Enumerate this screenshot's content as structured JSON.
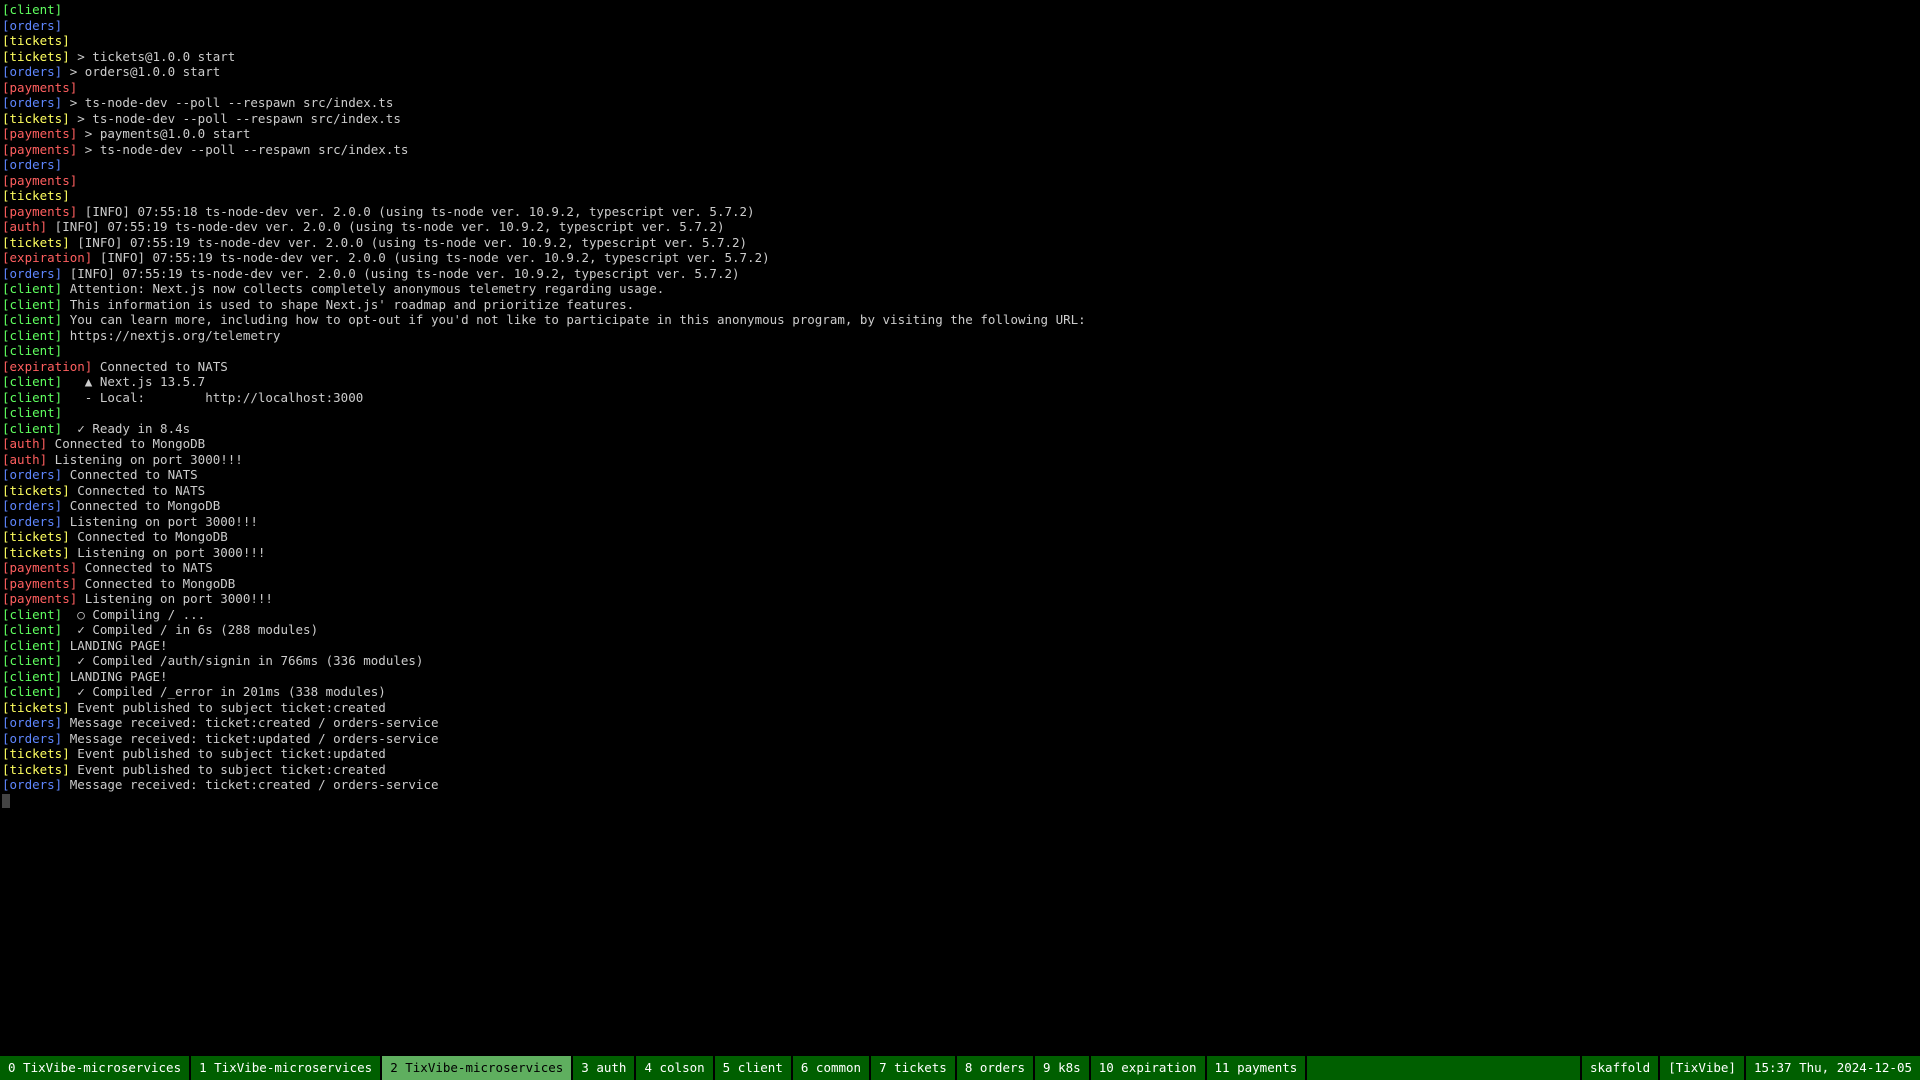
{
  "lines": [
    {
      "tag": "client",
      "text": ""
    },
    {
      "tag": "orders",
      "text": ""
    },
    {
      "tag": "tickets",
      "text": ""
    },
    {
      "tag": "tickets",
      "text": "> tickets@1.0.0 start"
    },
    {
      "tag": "orders",
      "text": "> orders@1.0.0 start"
    },
    {
      "tag": "payments",
      "text": ""
    },
    {
      "tag": "orders",
      "text": "> ts-node-dev --poll --respawn src/index.ts"
    },
    {
      "tag": "tickets",
      "text": "> ts-node-dev --poll --respawn src/index.ts"
    },
    {
      "tag": "payments",
      "text": "> payments@1.0.0 start"
    },
    {
      "tag": "payments",
      "text": "> ts-node-dev --poll --respawn src/index.ts"
    },
    {
      "tag": "orders",
      "text": ""
    },
    {
      "tag": "payments",
      "text": ""
    },
    {
      "tag": "tickets",
      "text": ""
    },
    {
      "tag": "payments",
      "text": "[INFO] 07:55:18 ts-node-dev ver. 2.0.0 (using ts-node ver. 10.9.2, typescript ver. 5.7.2)"
    },
    {
      "tag": "auth",
      "text": "[INFO] 07:55:19 ts-node-dev ver. 2.0.0 (using ts-node ver. 10.9.2, typescript ver. 5.7.2)"
    },
    {
      "tag": "tickets",
      "text": "[INFO] 07:55:19 ts-node-dev ver. 2.0.0 (using ts-node ver. 10.9.2, typescript ver. 5.7.2)"
    },
    {
      "tag": "expiration",
      "text": "[INFO] 07:55:19 ts-node-dev ver. 2.0.0 (using ts-node ver. 10.9.2, typescript ver. 5.7.2)"
    },
    {
      "tag": "orders",
      "text": "[INFO] 07:55:19 ts-node-dev ver. 2.0.0 (using ts-node ver. 10.9.2, typescript ver. 5.7.2)"
    },
    {
      "tag": "client",
      "text": "Attention: Next.js now collects completely anonymous telemetry regarding usage."
    },
    {
      "tag": "client",
      "text": "This information is used to shape Next.js' roadmap and prioritize features."
    },
    {
      "tag": "client",
      "text": "You can learn more, including how to opt-out if you'd not like to participate in this anonymous program, by visiting the following URL:"
    },
    {
      "tag": "client",
      "text": "https://nextjs.org/telemetry"
    },
    {
      "tag": "client",
      "text": ""
    },
    {
      "tag": "expiration",
      "text": "Connected to NATS"
    },
    {
      "tag": "client",
      "text": "  ▲ Next.js 13.5.7"
    },
    {
      "tag": "client",
      "text": "  - Local:        http://localhost:3000"
    },
    {
      "tag": "client",
      "text": ""
    },
    {
      "tag": "client",
      "text": " ✓ Ready in 8.4s"
    },
    {
      "tag": "auth",
      "text": "Connected to MongoDB"
    },
    {
      "tag": "auth",
      "text": "Listening on port 3000!!!"
    },
    {
      "tag": "orders",
      "text": "Connected to NATS"
    },
    {
      "tag": "tickets",
      "text": "Connected to NATS"
    },
    {
      "tag": "orders",
      "text": "Connected to MongoDB"
    },
    {
      "tag": "orders",
      "text": "Listening on port 3000!!!"
    },
    {
      "tag": "tickets",
      "text": "Connected to MongoDB"
    },
    {
      "tag": "tickets",
      "text": "Listening on port 3000!!!"
    },
    {
      "tag": "payments",
      "text": "Connected to NATS"
    },
    {
      "tag": "payments",
      "text": "Connected to MongoDB"
    },
    {
      "tag": "payments",
      "text": "Listening on port 3000!!!"
    },
    {
      "tag": "client",
      "text": " ○ Compiling / ..."
    },
    {
      "tag": "client",
      "text": " ✓ Compiled / in 6s (288 modules)"
    },
    {
      "tag": "client",
      "text": "LANDING PAGE!"
    },
    {
      "tag": "client",
      "text": " ✓ Compiled /auth/signin in 766ms (336 modules)"
    },
    {
      "tag": "client",
      "text": "LANDING PAGE!"
    },
    {
      "tag": "client",
      "text": " ✓ Compiled /_error in 201ms (338 modules)"
    },
    {
      "tag": "tickets",
      "text": "Event published to subject ticket:created"
    },
    {
      "tag": "orders",
      "text": "Message received: ticket:created / orders-service"
    },
    {
      "tag": "orders",
      "text": "Message received: ticket:updated / orders-service"
    },
    {
      "tag": "tickets",
      "text": "Event published to subject ticket:updated"
    },
    {
      "tag": "tickets",
      "text": "Event published to subject ticket:created"
    },
    {
      "tag": "orders",
      "text": "Message received: ticket:created / orders-service"
    }
  ],
  "statusbar": {
    "windows": [
      {
        "index": "0",
        "name": "TixVibe-microservices",
        "active": false
      },
      {
        "index": "1",
        "name": "TixVibe-microservices",
        "active": false
      },
      {
        "index": "2",
        "name": "TixVibe-microservices",
        "active": true
      },
      {
        "index": "3",
        "name": "auth",
        "active": false
      },
      {
        "index": "4",
        "name": "colson",
        "active": false
      },
      {
        "index": "5",
        "name": "client",
        "active": false
      },
      {
        "index": "6",
        "name": "common",
        "active": false
      },
      {
        "index": "7",
        "name": "tickets",
        "active": false
      },
      {
        "index": "8",
        "name": "orders",
        "active": false
      },
      {
        "index": "9",
        "name": "k8s",
        "active": false
      },
      {
        "index": "10",
        "name": "expiration",
        "active": false
      },
      {
        "index": "11",
        "name": "payments",
        "active": false
      }
    ],
    "right": {
      "pane_title": "skaffold",
      "session": "[TixVibe]",
      "datetime": "15:37 Thu, 2024-12-05"
    }
  }
}
